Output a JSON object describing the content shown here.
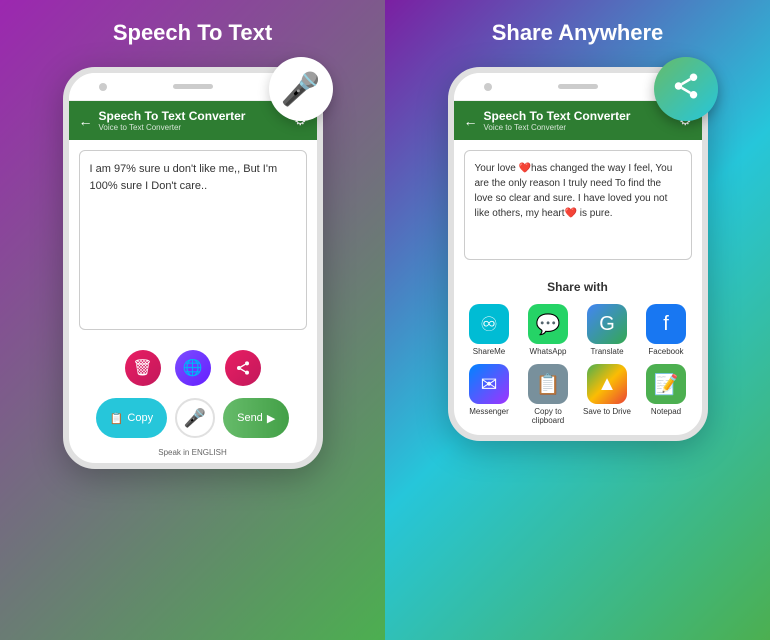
{
  "left": {
    "title": "Speech To Text",
    "phone": {
      "header": {
        "back": "←",
        "main_title": "Speech To Text Converter",
        "sub_title": "Voice to Text Converter",
        "gear": "⚙"
      },
      "text_content": "I am 97% sure u don't like me,, But I'm 100% sure I Don't care..",
      "action_buttons": {
        "delete": "🗑",
        "globe": "🌐",
        "share": "↗"
      },
      "bottom": {
        "copy_label": "Copy",
        "send_label": "Send",
        "speak_label": "Speak in ENGLISH"
      }
    }
  },
  "right": {
    "title": "Share Anywhere",
    "phone": {
      "header": {
        "back": "←",
        "main_title": "Speech To Text Converter",
        "sub_title": "Voice to Text Converter",
        "gear": "⚙"
      },
      "text_content": "Your love ❤️has changed the way I feel, You are the only reason I truly need To find the love so clear and sure. I have loved you not like others, my heart❤️ is pure.",
      "share_section": {
        "title": "Share with",
        "items": [
          {
            "label": "ShareMe",
            "icon_class": "icon-shareme",
            "icon": "♾"
          },
          {
            "label": "WhatsApp",
            "icon_class": "icon-whatsapp",
            "icon": "💬"
          },
          {
            "label": "Translate",
            "icon_class": "icon-translate",
            "icon": "G"
          },
          {
            "label": "Facebook",
            "icon_class": "icon-facebook",
            "icon": "f"
          },
          {
            "label": "Messenger",
            "icon_class": "icon-messenger",
            "icon": "✉"
          },
          {
            "label": "Copy to clipboard",
            "icon_class": "icon-clipboard",
            "icon": "📋"
          },
          {
            "label": "Save to Drive",
            "icon_class": "icon-drive",
            "icon": "▲"
          },
          {
            "label": "Notepad",
            "icon_class": "icon-notepad",
            "icon": "📝"
          }
        ]
      }
    }
  }
}
